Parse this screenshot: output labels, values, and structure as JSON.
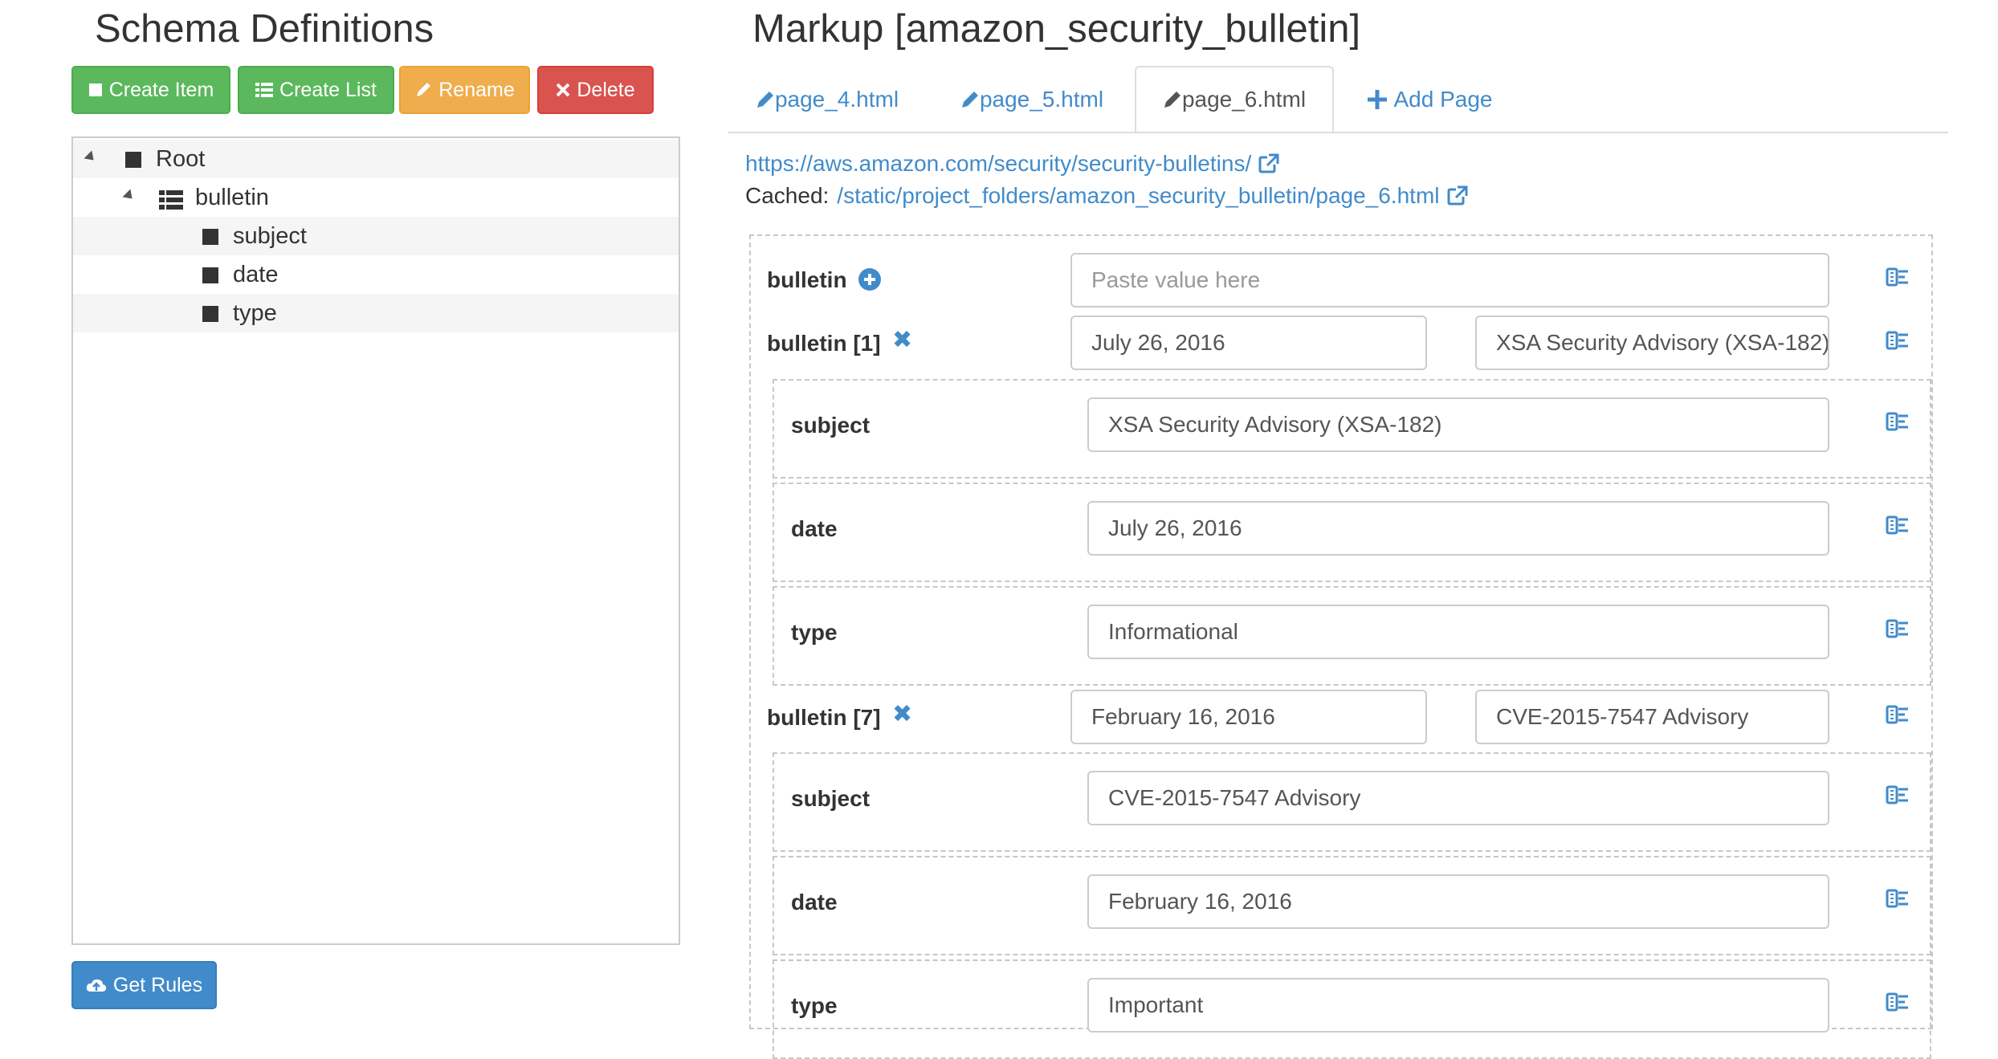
{
  "schema": {
    "title": "Schema Definitions",
    "buttons": {
      "create_item": "Create Item",
      "create_list": "Create List",
      "rename": "Rename",
      "delete": "Delete",
      "get_rules": "Get Rules"
    },
    "tree": [
      {
        "label": "Root",
        "kind": "item",
        "expanded": true
      },
      {
        "label": "bulletin",
        "kind": "list",
        "expanded": true
      },
      {
        "label": "subject",
        "kind": "item"
      },
      {
        "label": "date",
        "kind": "item"
      },
      {
        "label": "type",
        "kind": "item"
      }
    ]
  },
  "markup": {
    "title": "Markup [amazon_security_bulletin]",
    "tabs": [
      {
        "label": "page_4.html",
        "active": false
      },
      {
        "label": "page_5.html",
        "active": false
      },
      {
        "label": "page_6.html",
        "active": true
      }
    ],
    "add_page": "Add Page",
    "source_url": "https://aws.amazon.com/security/security-bulletins/",
    "cached_label": "Cached:",
    "cached_url": "/static/project_folders/amazon_security_bulletin/page_6.html",
    "bulletin_label": "bulletin",
    "bulletin_placeholder": "Paste value here",
    "entries": [
      {
        "label": "bulletin [1]",
        "summary_date": "July 26, 2016",
        "summary_subject": "XSA Security Advisory (XSA-182)",
        "fields": [
          {
            "label": "subject",
            "value": "XSA Security Advisory (XSA-182)"
          },
          {
            "label": "date",
            "value": "July 26, 2016"
          },
          {
            "label": "type",
            "value": "Informational"
          }
        ]
      },
      {
        "label": "bulletin [7]",
        "summary_date": "February 16, 2016",
        "summary_subject": "CVE-2015-7547 Advisory",
        "fields": [
          {
            "label": "subject",
            "value": "CVE-2015-7547 Advisory"
          },
          {
            "label": "date",
            "value": "February 16, 2016"
          },
          {
            "label": "type",
            "value": "Important"
          }
        ]
      }
    ]
  },
  "colors": {
    "success": "#5cb85c",
    "warning": "#f0ad4e",
    "danger": "#d9534f",
    "primary": "#428bca"
  },
  "icons": [
    "square-icon",
    "list-icon",
    "pencil-icon",
    "x-icon",
    "upload-cloud-icon",
    "plus-icon",
    "plus-circle-icon",
    "external-link-icon",
    "selector-icon",
    "expand-triangle-icon"
  ]
}
